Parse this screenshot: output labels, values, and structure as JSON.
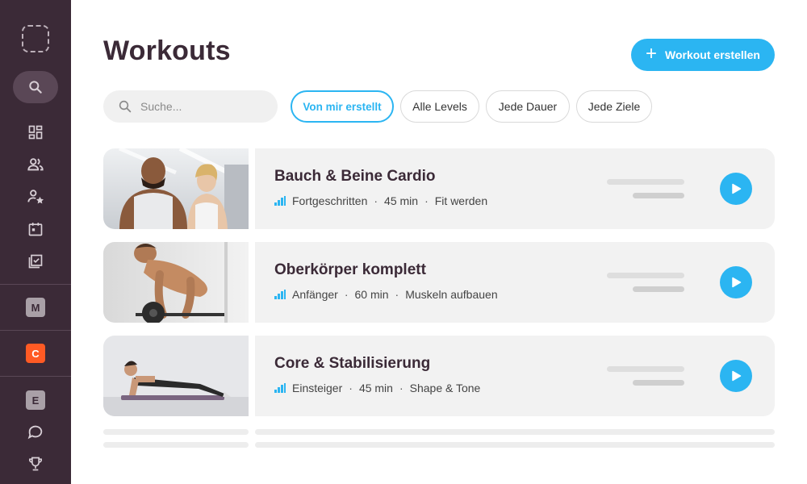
{
  "page": {
    "title": "Workouts",
    "create_button": "Workout erstellen"
  },
  "search": {
    "placeholder": "Suche..."
  },
  "filters": [
    {
      "label": "Von mir erstellt",
      "active": true
    },
    {
      "label": "Alle Levels",
      "active": false
    },
    {
      "label": "Jede Dauer",
      "active": false
    },
    {
      "label": "Jede Ziele",
      "active": false
    }
  ],
  "sidebar": {
    "letters": [
      {
        "letter": "M",
        "bg": "#a9a0a7",
        "fg": "#3b2a37"
      },
      {
        "letter": "C",
        "bg": "#ff5a24",
        "fg": "#ffffff"
      },
      {
        "letter": "E",
        "bg": "#a9a0a7",
        "fg": "#3b2a37"
      }
    ],
    "icons": [
      "search-icon",
      "dashboard-icon",
      "people-icon",
      "person-star-icon",
      "calendar-icon",
      "checklist-icon",
      "chat-icon",
      "trophy-icon"
    ]
  },
  "workouts": [
    {
      "title": "Bauch & Beine Cardio",
      "level": "Fortgeschritten",
      "duration": "45 min",
      "goal": "Fit werden",
      "image": "couple-gym-photo"
    },
    {
      "title": "Oberkörper komplett",
      "level": "Anfänger",
      "duration": "60 min",
      "goal": "Muskeln aufbauen",
      "image": "barbell-row-photo"
    },
    {
      "title": "Core & Stabilisierung",
      "level": "Einsteiger",
      "duration": "45 min",
      "goal": "Shape & Tone",
      "image": "plank-photo"
    }
  ],
  "colors": {
    "accent": "#2bb5f2",
    "sidebar": "#3b2a37",
    "title": "#3b2a37"
  }
}
